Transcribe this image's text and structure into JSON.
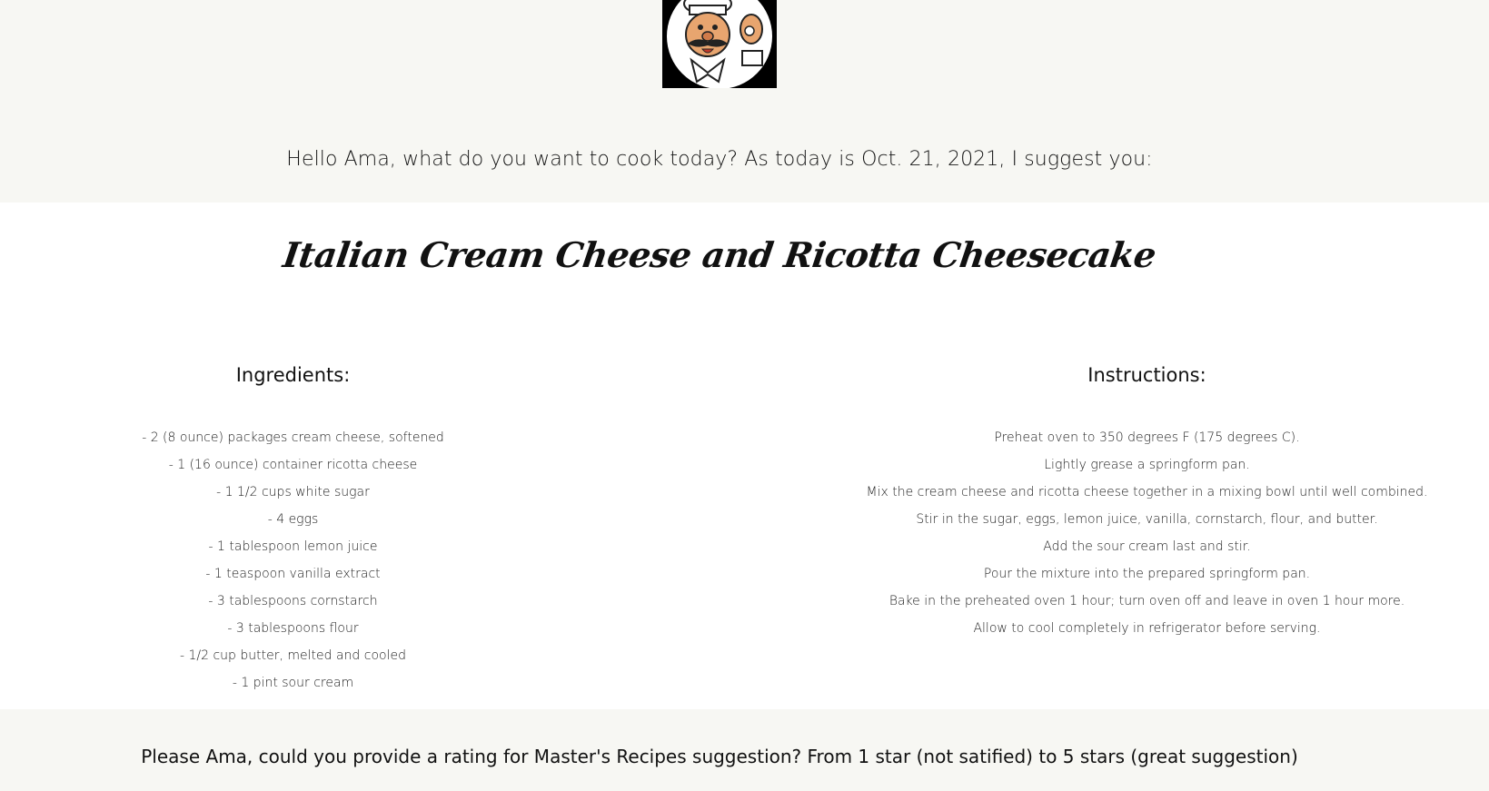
{
  "header": {
    "greeting": "Hello Ama, what do you want to cook today? As today is Oct. 21, 2021, I suggest you:",
    "logo_icon": "chef-mascot-icon"
  },
  "recipe": {
    "title": "Italian Cream Cheese and Ricotta Cheesecake",
    "ingredients_heading": "Ingredients:",
    "ingredients": [
      "- 2 (8 ounce) packages cream cheese, softened",
      "- 1 (16 ounce) container ricotta cheese",
      "- 1 1/2 cups white sugar",
      "- 4 eggs",
      "- 1 tablespoon lemon juice",
      "- 1 teaspoon vanilla extract",
      "- 3 tablespoons cornstarch",
      "- 3 tablespoons flour",
      "- 1/2 cup butter, melted and cooled",
      "- 1 pint sour cream"
    ],
    "instructions_heading": "Instructions:",
    "instructions": [
      "Preheat oven to 350 degrees F (175 degrees C).",
      "Lightly grease a springform pan.",
      "Mix the cream cheese and ricotta cheese together in a mixing bowl until well combined.",
      "Stir in the sugar, eggs, lemon juice, vanilla, cornstarch, flour, and butter.",
      "Add the sour cream last and stir.",
      "Pour the mixture into the prepared springform pan.",
      "Bake in the preheated oven 1 hour; turn oven off and leave in oven 1 hour more.",
      "Allow to cool completely in refrigerator before serving."
    ]
  },
  "rating": {
    "prompt": "Please Ama, could you provide a rating for Master's Recipes suggestion? From 1 star (not satified) to 5 stars (great suggestion)"
  },
  "colors": {
    "band_background": "#f7f7f3",
    "main_background": "#ffffff",
    "text": "#111111"
  }
}
